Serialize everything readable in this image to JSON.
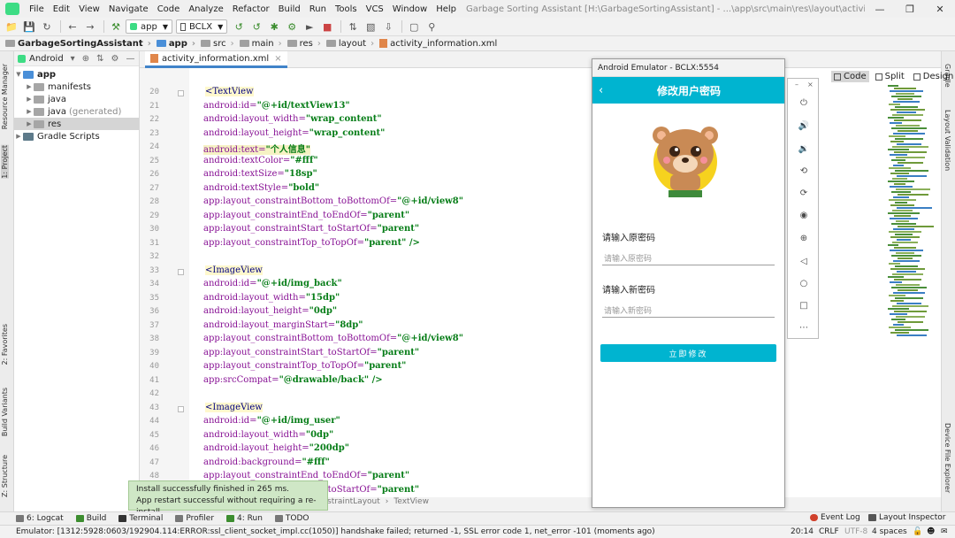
{
  "menubar": {
    "items": [
      "File",
      "Edit",
      "View",
      "Navigate",
      "Code",
      "Analyze",
      "Refactor",
      "Build",
      "Run",
      "Tools",
      "VCS",
      "Window",
      "Help"
    ],
    "window_title": "Garbage Sorting Assistant [H:\\GarbageSortingAssistant] - ...\\app\\src\\main\\res\\layout\\activity_information.xml [app]"
  },
  "toolbar": {
    "module": "app",
    "device": "BCLX"
  },
  "breadcrumb": [
    "GarbageSortingAssistant",
    "app",
    "src",
    "main",
    "res",
    "layout",
    "activity_information.xml"
  ],
  "left_strip": [
    "Resource Manager",
    "1: Project",
    "2: Favorites",
    "Build Variants",
    "Z: Structure"
  ],
  "right_strip": [
    "Gradle",
    "Layout Validation",
    "Device File Explorer"
  ],
  "project": {
    "view": "Android",
    "tree": [
      {
        "label": "app",
        "extra": ""
      },
      {
        "label": "manifests",
        "extra": ""
      },
      {
        "label": "java",
        "extra": ""
      },
      {
        "label": "java",
        "extra": "(generated)"
      },
      {
        "label": "res",
        "extra": ""
      },
      {
        "label": "Gradle Scripts",
        "extra": ""
      }
    ]
  },
  "editor": {
    "tab": "activity_information.xml",
    "line_numbers": [
      "20",
      "21",
      "22",
      "23",
      "24",
      "25",
      "26",
      "27",
      "28",
      "29",
      "30",
      "31",
      "32",
      "33",
      "34",
      "35",
      "36",
      "37",
      "38",
      "39",
      "40",
      "41",
      "42",
      "43",
      "44",
      "45",
      "46",
      "47",
      "48",
      "49"
    ],
    "lines": [
      {
        "tag": "<TextView"
      },
      {
        "attr": "android:id=",
        "val": "\"@+id/textView13\""
      },
      {
        "attr": "android:layout_width=",
        "val": "\"wrap_content\""
      },
      {
        "attr": "android:layout_height=",
        "val": "\"wrap_content\""
      },
      {
        "attr": "android:text=",
        "val": "\"个人信息\""
      },
      {
        "attr": "android:textColor=",
        "val": "\"#fff\""
      },
      {
        "attr": "android:textSize=",
        "val": "\"18sp\""
      },
      {
        "attr": "android:textStyle=",
        "val": "\"bold\""
      },
      {
        "attr": "app:layout_constraintBottom_toBottomOf=",
        "val": "\"@+id/view8\""
      },
      {
        "attr": "app:layout_constraintEnd_toEndOf=",
        "val": "\"parent\""
      },
      {
        "attr": "app:layout_constraintStart_toStartOf=",
        "val": "\"parent\""
      },
      {
        "attr": "app:layout_constraintTop_toTopOf=",
        "val": "\"parent\" />"
      },
      {
        "attr": "",
        "val": ""
      },
      {
        "tag": "<ImageView"
      },
      {
        "attr": "android:id=",
        "val": "\"@+id/img_back\""
      },
      {
        "attr": "android:layout_width=",
        "val": "\"15dp\""
      },
      {
        "attr": "android:layout_height=",
        "val": "\"0dp\""
      },
      {
        "attr": "android:layout_marginStart=",
        "val": "\"8dp\""
      },
      {
        "attr": "app:layout_constraintBottom_toBottomOf=",
        "val": "\"@+id/view8\""
      },
      {
        "attr": "app:layout_constraintStart_toStartOf=",
        "val": "\"parent\""
      },
      {
        "attr": "app:layout_constraintTop_toTopOf=",
        "val": "\"parent\""
      },
      {
        "attr": "app:srcCompat=",
        "val": "\"@drawable/back\" />"
      },
      {
        "attr": "",
        "val": ""
      },
      {
        "tag": "<ImageView"
      },
      {
        "attr": "android:id=",
        "val": "\"@+id/img_user\""
      },
      {
        "attr": "android:layout_width=",
        "val": "\"0dp\""
      },
      {
        "attr": "android:layout_height=",
        "val": "\"200dp\""
      },
      {
        "attr": "android:background=",
        "val": "\"#fff\""
      },
      {
        "attr": "app:layout_constraintEnd_toEndOf=",
        "val": "\"parent\""
      },
      {
        "attr": "app:layout_constraintStart_toStartOf=",
        "val": "\"parent\""
      }
    ],
    "view_modes": [
      "Code",
      "Split",
      "Design"
    ],
    "status_crumbs": [
      "straintLayout",
      "TextView"
    ]
  },
  "emulator": {
    "window_title": "Android Emulator - BCLX:5554",
    "screen_title": "修改用户密码",
    "old_pw_label": "请输入原密码",
    "old_pw_placeholder": "请输入原密码",
    "new_pw_label": "请输入新密码",
    "new_pw_placeholder": "请输入新密码",
    "submit": "立即修改"
  },
  "balloon": {
    "line1": "Install successfully finished in 265 ms.",
    "line2": "App restart successful without requiring a re-install."
  },
  "bottom_tools": [
    "6: Logcat",
    "Build",
    "Terminal",
    "Profiler",
    "4: Run",
    "TODO"
  ],
  "bottom_right": [
    "Event Log",
    "Layout Inspector"
  ],
  "statusbar": {
    "message": "Emulator: [1312:5928:0603/192904.114:ERROR:ssl_client_socket_impl.cc(1050)] handshake failed; returned -1, SSL error code 1, net_error -101 (moments ago)",
    "position": "20:14",
    "line_sep": "CRLF",
    "encoding": "UTF-8",
    "indent": "4 spaces"
  }
}
